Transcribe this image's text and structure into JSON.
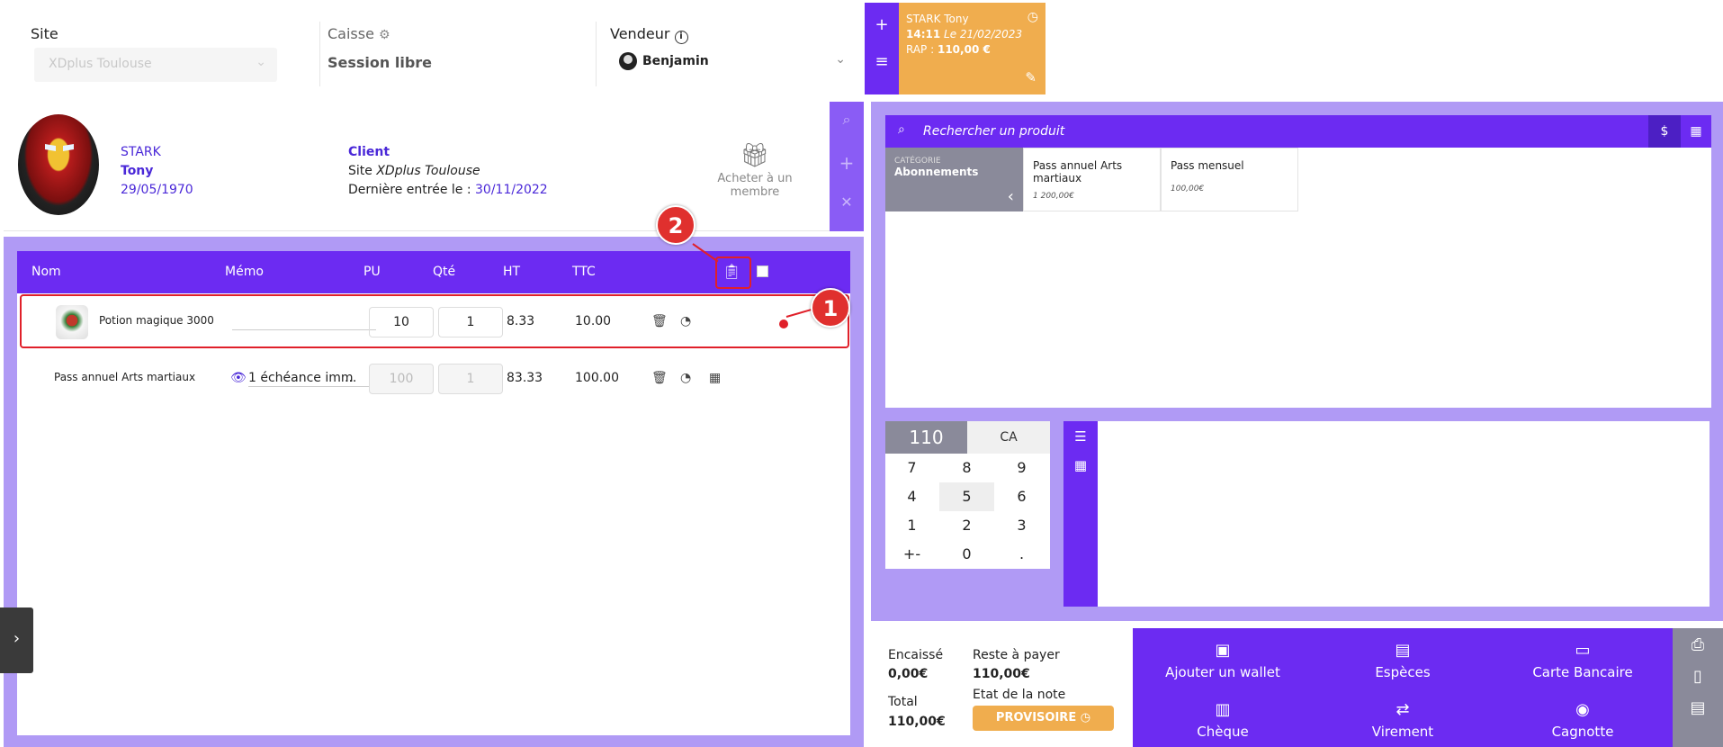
{
  "topbar": {
    "site_label": "Site",
    "site_value": "XDplus Toulouse",
    "caisse_label": "Caisse",
    "caisse_value": "Session libre",
    "vendeur_label": "Vendeur",
    "vendeur_value": "Benjamin"
  },
  "ticket": {
    "name": "STARK Tony",
    "time": "14:11",
    "date": "Le 21/02/2023",
    "rap_label": "RAP :",
    "rap_value": "110,00 €"
  },
  "client": {
    "lastname": "STARK",
    "firstname": "Tony",
    "birthdate": "29/05/1970",
    "type": "Client",
    "site_prefix": "Site",
    "site": "XDplus Toulouse",
    "last_entry_label": "Dernière entrée le :",
    "last_entry_date": "30/11/2022",
    "gift_label": "Acheter à un membre"
  },
  "cart": {
    "headers": {
      "nom": "Nom",
      "memo": "Mémo",
      "pu": "PU",
      "qte": "Qté",
      "ht": "HT",
      "ttc": "TTC"
    },
    "rows": [
      {
        "name": "Potion magique 3000",
        "memo": "",
        "pu": "10",
        "qte": "1",
        "ht": "8.33",
        "ttc": "10.00"
      },
      {
        "name": "Pass annuel Arts martiaux",
        "memo": "1 échéance imm",
        "memo_more": "...",
        "pu": "100",
        "qte": "1",
        "ht": "83.33",
        "ttc": "100.00"
      }
    ]
  },
  "annotations": {
    "badge1": "1",
    "badge2": "2"
  },
  "products": {
    "search_placeholder": "Rechercher un produit",
    "category_label": "CATÉGORIE",
    "category_name": "Abonnements",
    "items": [
      {
        "name": "Pass annuel Arts martiaux",
        "price": "1 200,00€"
      },
      {
        "name": "Pass mensuel",
        "price": "100,00€"
      }
    ]
  },
  "keypad": {
    "display": "110",
    "ca": "CA",
    "keys": [
      "7",
      "8",
      "9",
      "4",
      "5",
      "6",
      "1",
      "2",
      "3",
      "+-",
      "0",
      "."
    ]
  },
  "payment": {
    "encaisse_label": "Encaissé",
    "encaisse_value": "0,00€",
    "reste_label": "Reste à payer",
    "reste_value": "110,00€",
    "total_label": "Total",
    "total_value": "110,00€",
    "etat_label": "Etat de la note",
    "etat_value": "PROVISOIRE",
    "methods": [
      {
        "label": "Ajouter un wallet",
        "icon": "wallet-icon"
      },
      {
        "label": "Espèces",
        "icon": "cash-icon"
      },
      {
        "label": "Carte Bancaire",
        "icon": "credit-card-icon"
      },
      {
        "label": "Chèque",
        "icon": "cheque-icon"
      },
      {
        "label": "Virement",
        "icon": "transfer-icon"
      },
      {
        "label": "Cagnotte",
        "icon": "piggy-bank-icon"
      }
    ]
  },
  "colors": {
    "primary": "#6c2bf2",
    "light": "#b09af5",
    "orange": "#f0ad4e",
    "annotation_red": "#e0202a"
  }
}
